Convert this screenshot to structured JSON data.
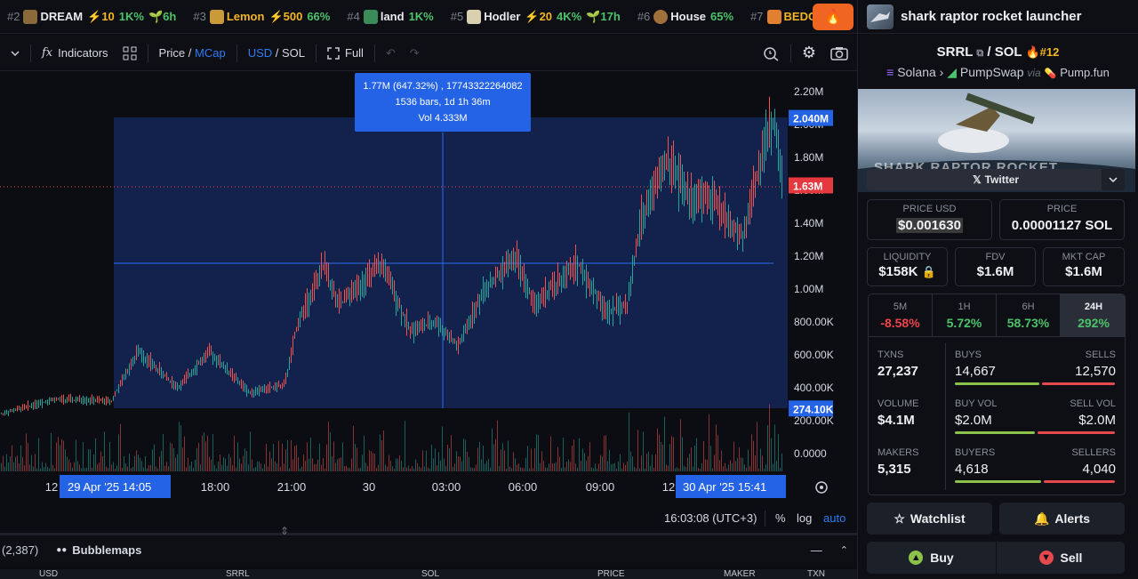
{
  "ticker": [
    {
      "rank": "#2",
      "name": "DREAM",
      "boost": "⚡10",
      "pct": "1K%",
      "age": "6h",
      "color": "#8a6a3a"
    },
    {
      "rank": "#3",
      "name": "Lemon",
      "boost": "⚡500",
      "pct": "66%",
      "age": "",
      "color": "#c89a3a",
      "name_gold": true
    },
    {
      "rank": "#4",
      "name": "land",
      "boost": "",
      "pct": "1K%",
      "age": "",
      "color": "#3a8a5a"
    },
    {
      "rank": "#5",
      "name": "Hodler",
      "boost": "⚡20",
      "pct": "4K%",
      "age": "17h",
      "color": "#d8d0b0"
    },
    {
      "rank": "#6",
      "name": "House",
      "boost": "",
      "pct": "65%",
      "age": "",
      "color": "#a0703a"
    },
    {
      "rank": "#7",
      "name": "BEDCOI",
      "boost": "",
      "pct": "",
      "age": "",
      "color": "#e08030",
      "name_gold": true
    }
  ],
  "toolbar": {
    "indicators": "Indicators",
    "price": "Price",
    "mcap": "MCap",
    "usd": "USD",
    "sol": "SOL",
    "full": "Full"
  },
  "tooltip": {
    "line1": "1.77M (647.32%) , 17743322264082",
    "line2": "1536 bars, 1d 1h 36m",
    "line3": "Vol 4.333M"
  },
  "axis": {
    "y_ticks": [
      "2.20M",
      "2.00M",
      "1.80M",
      "1.60M",
      "1.40M",
      "1.20M",
      "1.00M",
      "800.00K",
      "600.00K",
      "400.00K",
      "200.00K",
      "0.0000"
    ],
    "upper_tag": "2.040M",
    "current_tag": "1.63M",
    "lower_tag": "274.10K",
    "x_ticks": [
      "12",
      "18:00",
      "21:00",
      "30",
      "03:00",
      "06:00",
      "09:00",
      "12"
    ],
    "x_start_tag": "29 Apr '25    14:05",
    "x_end_tag": "30 Apr '25    15:41"
  },
  "status": {
    "time": "16:03:08 (UTC+3)",
    "percent": "%",
    "log": "log",
    "auto": "auto"
  },
  "panel": {
    "count": "(2,387)",
    "bubblemaps": "Bubblemaps",
    "cols": [
      "USD",
      "SRRL",
      "SOL",
      "PRICE",
      "MAKER",
      "TXN"
    ]
  },
  "token": {
    "name": "shark raptor rocket launcher",
    "symbol": "SRRL",
    "quote": "SOL",
    "rank": "#12",
    "chain": "Solana",
    "dex": "PumpSwap",
    "via": "via",
    "launchpad": "Pump.fun",
    "banner_text": "SHARK RAPTOR ROCKET LAUNCHER",
    "twitter": "Twitter"
  },
  "prices": {
    "usd_label": "PRICE USD",
    "usd": "$0.001630",
    "sol_label": "PRICE",
    "sol": "0.00001127 SOL"
  },
  "metrics": [
    {
      "label": "LIQUIDITY",
      "value": "$158K"
    },
    {
      "label": "FDV",
      "value": "$1.6M"
    },
    {
      "label": "MKT CAP",
      "value": "$1.6M"
    }
  ],
  "timeframes": [
    {
      "label": "5M",
      "value": "-8.58%",
      "color": "#f0434d"
    },
    {
      "label": "1H",
      "value": "5.72%",
      "color": "#4cc36b"
    },
    {
      "label": "6H",
      "value": "58.73%",
      "color": "#4cc36b"
    },
    {
      "label": "24H",
      "value": "292%",
      "color": "#4cc36b"
    }
  ],
  "stats": {
    "txns_label": "TXNS",
    "txns": "27,237",
    "buys_label": "BUYS",
    "buys": "14,667",
    "sells_label": "SELLS",
    "sells": "12,570",
    "volume_label": "VOLUME",
    "volume": "$4.1M",
    "buyvol_label": "BUY VOL",
    "buyvol": "$2.0M",
    "sellvol_label": "SELL VOL",
    "sellvol": "$2.0M",
    "makers_label": "MAKERS",
    "makers": "5,315",
    "buyers_label": "BUYERS",
    "buyers": "4,618",
    "sellers_label": "SELLERS",
    "sellers": "4,040"
  },
  "actions": {
    "watchlist": "Watchlist",
    "alerts": "Alerts",
    "buy": "Buy",
    "sell": "Sell"
  },
  "colors": {
    "up": "#26a69a",
    "down": "#ef5350",
    "accent": "#2f7cf6",
    "orange": "#f06522"
  }
}
